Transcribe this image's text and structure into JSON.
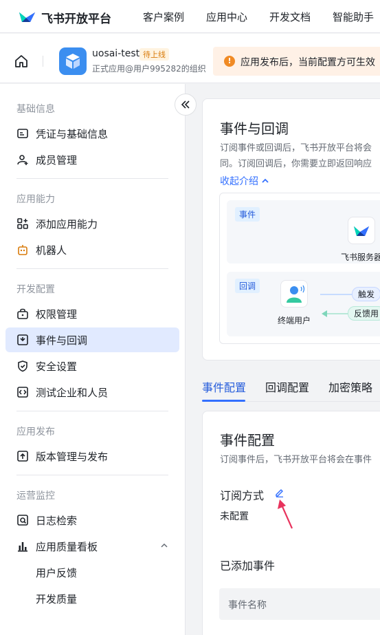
{
  "header": {
    "brand": "飞书开放平台",
    "nav": [
      "客户案例",
      "应用中心",
      "开发文档",
      "智能助手"
    ],
    "logo_icon": "feishu-logo-icon"
  },
  "app": {
    "name": "uosai-test",
    "status": "待上线",
    "subtitle": "正式应用@用户995282的组织",
    "notice": "应用发布后，当前配置方可生效"
  },
  "sidebar": {
    "groups": {
      "basic": "基础信息",
      "ability": "应用能力",
      "dev": "开发配置",
      "release": "应用发布",
      "monitor": "运营监控"
    },
    "items": {
      "credentials": "凭证与基础信息",
      "members": "成员管理",
      "add_ability": "添加应用能力",
      "robot": "机器人",
      "permissions": "权限管理",
      "events": "事件与回调",
      "security": "安全设置",
      "test_enterprise": "测试企业和人员",
      "version": "版本管理与发布",
      "log_search": "日志检索",
      "quality_board": "应用质量看板",
      "user_feedback": "用户反馈",
      "dev_quality": "开发质量"
    },
    "active": "events"
  },
  "intro": {
    "title": "事件与回调",
    "desc_line1": "订阅事件或回调后，飞书开放平台将会",
    "desc_line2": "同。订阅回调后，你需要立即返回响应",
    "collapse": "收起介绍",
    "diagram": {
      "event_tag": "事件",
      "callback_tag": "回调",
      "server_label": "飞书服务器",
      "user_label": "终端用户",
      "trigger_label": "触发",
      "feedback_label": "反馈用"
    }
  },
  "tabs": {
    "items": [
      "事件配置",
      "回调配置",
      "加密策略"
    ],
    "active": 0
  },
  "event_config": {
    "title": "事件配置",
    "desc": "订阅事件后，飞书开放平台将会在事件",
    "subscribe_label": "订阅方式",
    "subscribe_value": "未配置",
    "added_label": "已添加事件",
    "table_col_name": "事件名称"
  },
  "colors": {
    "accent": "#3370ff",
    "active_bg": "#e1eaff",
    "notice_bg": "#fff1e6",
    "annotation_arrow": "#e8335d"
  }
}
